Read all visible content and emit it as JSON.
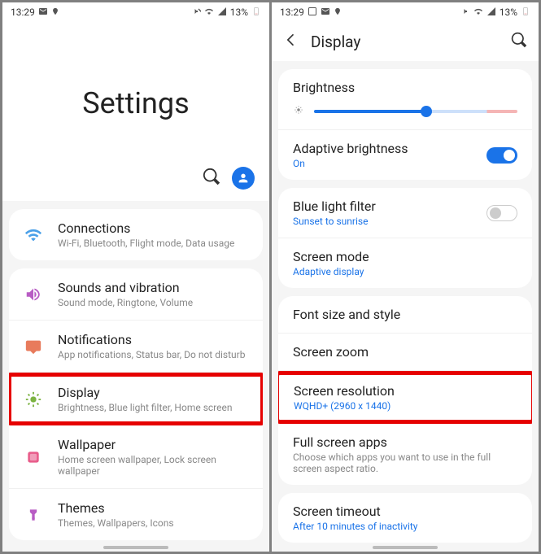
{
  "status": {
    "time": "13:29",
    "battery": "13%"
  },
  "screen1": {
    "title": "Settings",
    "items": [
      {
        "title": "Connections",
        "sub": "Wi-Fi, Bluetooth, Flight mode, Data usage"
      },
      {
        "title": "Sounds and vibration",
        "sub": "Sound mode, Ringtone, Volume"
      },
      {
        "title": "Notifications",
        "sub": "App notifications, Status bar, Do not disturb"
      },
      {
        "title": "Display",
        "sub": "Brightness, Blue light filter, Home screen"
      },
      {
        "title": "Wallpaper",
        "sub": "Home screen wallpaper, Lock screen wallpaper"
      },
      {
        "title": "Themes",
        "sub": "Themes, Wallpapers, Icons"
      }
    ]
  },
  "screen2": {
    "header": "Display",
    "brightness_label": "Brightness",
    "adaptive": {
      "title": "Adaptive brightness",
      "sub": "On"
    },
    "bluelight": {
      "title": "Blue light filter",
      "sub": "Sunset to sunrise"
    },
    "screenmode": {
      "title": "Screen mode",
      "sub": "Adaptive display"
    },
    "fontsize": "Font size and style",
    "screenzoom": "Screen zoom",
    "resolution": {
      "title": "Screen resolution",
      "sub": "WQHD+ (2960 x 1440)"
    },
    "fullscreen": {
      "title": "Full screen apps",
      "sub": "Choose which apps you want to use in the full screen aspect ratio."
    },
    "timeout": {
      "title": "Screen timeout",
      "sub": "After 10 minutes of inactivity"
    }
  }
}
